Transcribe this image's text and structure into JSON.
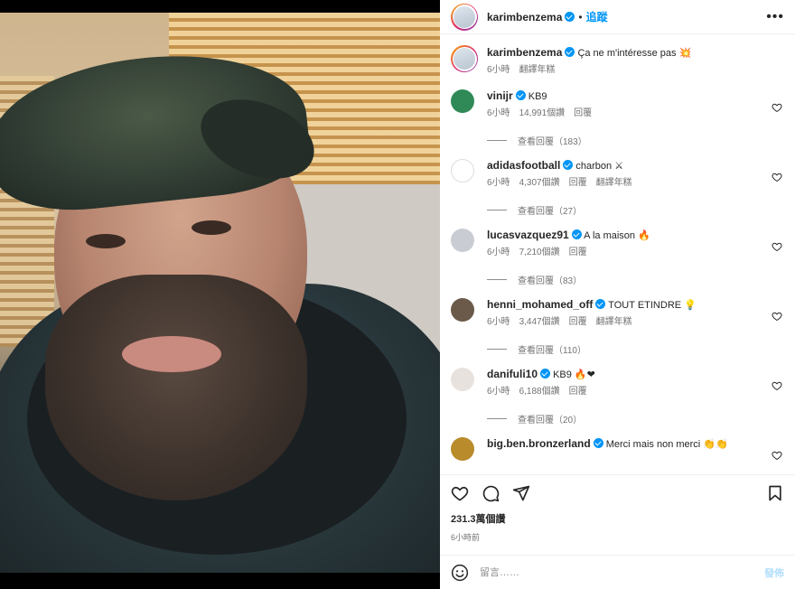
{
  "header": {
    "username": "karimbenzema",
    "dot": "•",
    "follow": "追蹤",
    "more": "•••"
  },
  "caption": {
    "username": "karimbenzema",
    "text": "Ça ne m'intéresse pas 💥",
    "time": "6小時",
    "translate": "翻譯年糕"
  },
  "comments": [
    {
      "username": "vinijr",
      "verified": true,
      "text": "KB9",
      "time": "6小時",
      "likes": "14,991個讚",
      "reply": "回覆",
      "translate": "",
      "replies": "查看回覆（183）",
      "avatar_color": "#2f8a57"
    },
    {
      "username": "adidasfootball",
      "verified": true,
      "text": "charbon ⚔",
      "time": "6小時",
      "likes": "4,307個讚",
      "reply": "回覆",
      "translate": "翻譯年糕",
      "replies": "查看回覆（27）",
      "avatar_color": "#ffffff"
    },
    {
      "username": "lucasvazquez91",
      "verified": true,
      "text": "A la maison 🔥",
      "time": "6小時",
      "likes": "7,210個讚",
      "reply": "回覆",
      "translate": "",
      "replies": "查看回覆（83）",
      "avatar_color": "#c9ccd3"
    },
    {
      "username": "henni_mohamed_off",
      "verified": true,
      "text": "TOUT ETINDRE 💡",
      "time": "6小時",
      "likes": "3,447個讚",
      "reply": "回覆",
      "translate": "翻譯年糕",
      "replies": "查看回覆（110）",
      "avatar_color": "#6b5a4a"
    },
    {
      "username": "danifuli10",
      "verified": true,
      "text": "KB9 🔥❤",
      "time": "6小時",
      "likes": "6,188個讚",
      "reply": "回覆",
      "translate": "",
      "replies": "查看回覆（20）",
      "avatar_color": "#e8e2de"
    },
    {
      "username": "big.ben.bronzerland",
      "verified": true,
      "text": "Merci mais non merci 👏👏",
      "time": "",
      "likes": "",
      "reply": "",
      "translate": "",
      "replies": "",
      "avatar_color": "#b98b2b"
    }
  ],
  "actions": {
    "like_icon": "heart-icon",
    "comment_icon": "comment-icon",
    "share_icon": "share-icon",
    "save_icon": "bookmark-icon"
  },
  "likes": "231.3萬個讚",
  "post_time": "6小時前",
  "add_comment": {
    "emoji_icon": "smiley-icon",
    "placeholder": "留言……",
    "post": "發佈"
  },
  "colors": {
    "accent": "#0095f6",
    "muted": "#737373",
    "post_disabled": "#b2dffc"
  }
}
